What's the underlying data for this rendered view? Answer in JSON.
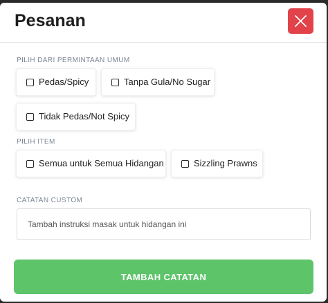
{
  "modal": {
    "title": "Pesanan",
    "close_icon": "close-x-icon",
    "accent_close": "#e2434b",
    "accent_submit": "#5dc46a"
  },
  "common_requests": {
    "label": "PILIH DARI PERMINTAAN UMUM",
    "options": [
      {
        "label": "Pedas/Spicy",
        "checked": false
      },
      {
        "label": "Tanpa Gula/No Sugar",
        "checked": false
      },
      {
        "label": "Tidak Pedas/Not Spicy",
        "checked": false
      }
    ]
  },
  "items": {
    "label": "PILIH ITEM",
    "options": [
      {
        "label": "Semua untuk Semua Hidangan",
        "checked": false
      },
      {
        "label": "Sizzling Prawns",
        "checked": false
      }
    ]
  },
  "custom_note": {
    "label": "CATATAN CUSTOM",
    "placeholder": "Tambah instruksi masak untuk hidangan ini",
    "value": ""
  },
  "submit": {
    "label": "TAMBAH CATATAN"
  }
}
